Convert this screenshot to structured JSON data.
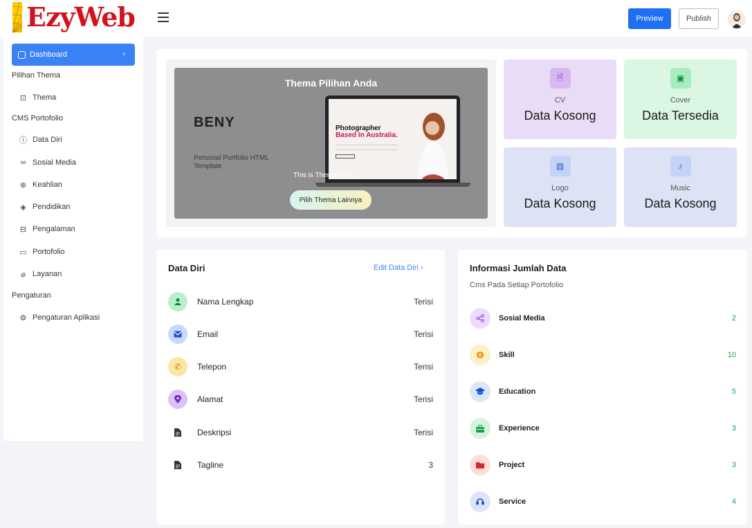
{
  "header": {
    "brand": "EzyWeb",
    "preview_label": "Preview",
    "publish_label": "Publish"
  },
  "sidebar": {
    "active_label": "Dashboard",
    "sections": [
      {
        "title": "Pilihan Thema",
        "items": [
          {
            "label": "Thema",
            "icon": "palette-icon"
          }
        ]
      },
      {
        "title": "CMS Portofolio",
        "items": [
          {
            "label": "Data Diri",
            "icon": "info-icon"
          },
          {
            "label": "Sosial Media",
            "icon": "link-icon"
          },
          {
            "label": "Keahlian",
            "icon": "star-icon"
          },
          {
            "label": "Pendidikan",
            "icon": "graduation-icon"
          },
          {
            "label": "Pengalaman",
            "icon": "briefcase-icon"
          },
          {
            "label": "Portofolio",
            "icon": "folder-icon"
          },
          {
            "label": "Layanan",
            "icon": "handshake-icon"
          }
        ]
      },
      {
        "title": "Pengaturan",
        "items": [
          {
            "label": "Pengaturan Aplikasi",
            "icon": "gear-icon"
          }
        ]
      }
    ]
  },
  "theme": {
    "title": "Thema Pilihan Anda",
    "name": "BENY",
    "subtitle": "Personal Portfolio HTML Template",
    "screen_line1": "Photographer",
    "screen_line2": "Based In Australia.",
    "caption": "This is Thema Beny",
    "button": "Pilih Thema Lainnya"
  },
  "stats": [
    {
      "label": "CV",
      "value": "Data Kosong",
      "bg": "#e9dcf7",
      "icon_bg": "#d7b9f2",
      "icon_color": "#8a3fd1"
    },
    {
      "label": "Cover",
      "value": "Data Tersedia",
      "bg": "#dbf7e3",
      "icon_bg": "#a8edbf",
      "icon_color": "#138a3c"
    },
    {
      "label": "Logo",
      "value": "Data Kosong",
      "bg": "#dde3f5",
      "icon_bg": "#c3d3f7",
      "icon_color": "#2a5bd7"
    },
    {
      "label": "Music",
      "value": "Data Kosong",
      "bg": "#dde3f5",
      "icon_bg": "#c3d3f7",
      "icon_color": "#2a5bd7"
    }
  ],
  "data_diri": {
    "title": "Data Diri",
    "edit_label": "Edit Data Diri",
    "rows": [
      {
        "label": "Nama Lengkap",
        "value": "Terisi",
        "icon": "user-icon",
        "bg": "#b9f0cc",
        "color": "#15803d"
      },
      {
        "label": "Email",
        "value": "Terisi",
        "icon": "mail-icon",
        "bg": "#c7d9f9",
        "color": "#1d4ed8"
      },
      {
        "label": "Telepon",
        "value": "Terisi",
        "icon": "phone-icon",
        "bg": "#fbe7a3",
        "color": "#d97706"
      },
      {
        "label": "Alamat",
        "value": "Terisi",
        "icon": "location-icon",
        "bg": "#dac4f6",
        "color": "#7e22ce"
      },
      {
        "label": "Deskripsi",
        "value": "Terisi",
        "icon": "document-icon",
        "bg": "#ffffff",
        "color": "#333333"
      },
      {
        "label": "Tagline",
        "value": "3",
        "icon": "document-icon",
        "bg": "#ffffff",
        "color": "#333333"
      }
    ]
  },
  "info": {
    "title": "Informasi Jumlah Data",
    "subtitle": "Cms Pada Setiap Portofolio",
    "rows": [
      {
        "label": "Sosial Media",
        "value": "2",
        "icon": "share-icon",
        "bg": "#ecdcfb",
        "color": "#9333ea"
      },
      {
        "label": "Skill",
        "value": "10",
        "icon": "brain-icon",
        "bg": "#fdf0c4",
        "color": "#ea8a0c"
      },
      {
        "label": "Education",
        "value": "5",
        "icon": "graduation-icon",
        "bg": "#dbe6f8",
        "color": "#1d4ed8"
      },
      {
        "label": "Experience",
        "value": "3",
        "icon": "briefcase-icon",
        "bg": "#d6f3df",
        "color": "#16a34a"
      },
      {
        "label": "Project",
        "value": "3",
        "icon": "folder-icon",
        "bg": "#fbdede",
        "color": "#dc2626"
      },
      {
        "label": "Service",
        "value": "4",
        "icon": "headset-icon",
        "bg": "#dbe6f8",
        "color": "#1d4ed8"
      }
    ]
  }
}
